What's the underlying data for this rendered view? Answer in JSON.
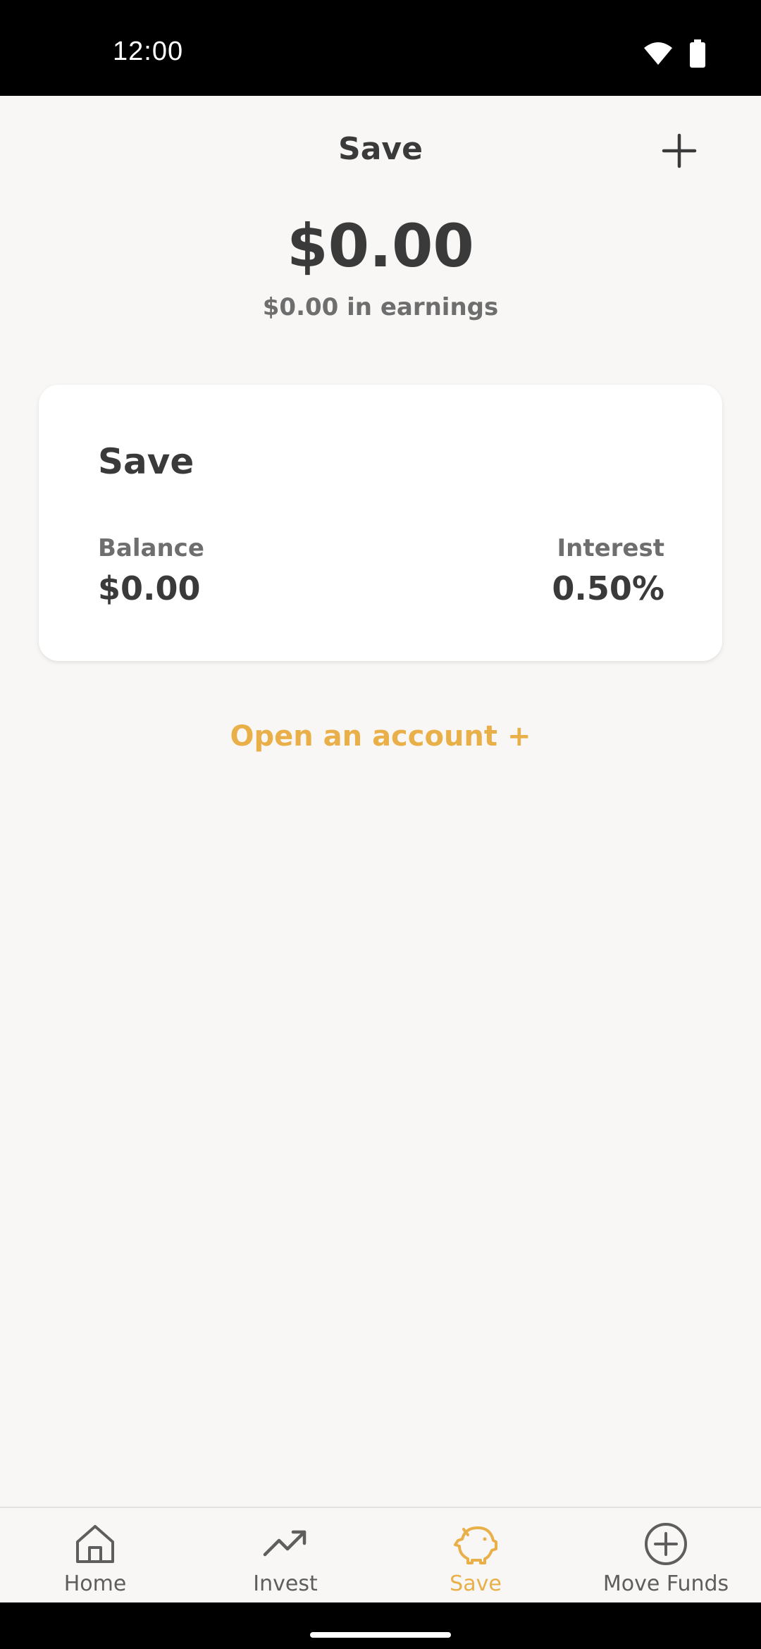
{
  "status_bar": {
    "time": "12:00",
    "icons": [
      "wifi-icon",
      "battery-icon"
    ]
  },
  "header": {
    "title": "Save",
    "add_icon": "plus-icon"
  },
  "summary": {
    "total": "$0.00",
    "earnings": "$0.00 in earnings"
  },
  "account_card": {
    "title": "Save",
    "balance_label": "Balance",
    "balance_value": "$0.00",
    "interest_label": "Interest",
    "interest_value": "0.50%"
  },
  "open_account": {
    "label": "Open an account +"
  },
  "bottom_nav": {
    "items": [
      {
        "label": "Home",
        "icon": "home-icon",
        "active": false
      },
      {
        "label": "Invest",
        "icon": "trending-up-icon",
        "active": false
      },
      {
        "label": "Save",
        "icon": "piggy-bank-icon",
        "active": true
      },
      {
        "label": "Move Funds",
        "icon": "plus-circle-icon",
        "active": false
      }
    ]
  },
  "colors": {
    "accent": "#E9B04A",
    "text_primary": "#3A3A3A",
    "text_secondary": "#6E6E6E",
    "background": "#F8F7F5",
    "card": "#FFFFFF"
  }
}
